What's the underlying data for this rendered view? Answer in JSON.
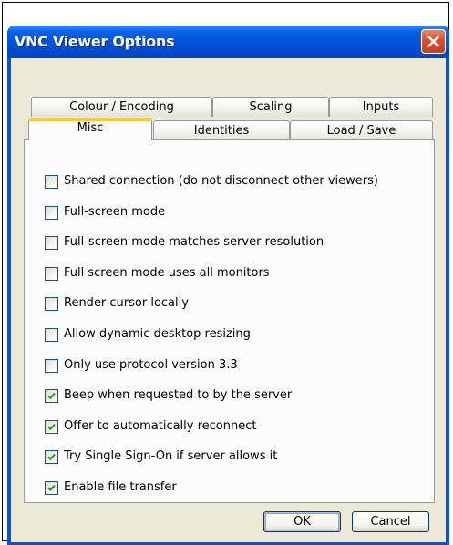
{
  "window": {
    "title": "VNC Viewer Options"
  },
  "tabs": {
    "row_back": [
      {
        "label": "Colour / Encoding"
      },
      {
        "label": "Scaling"
      },
      {
        "label": "Inputs"
      }
    ],
    "row_front": [
      {
        "label": "Misc",
        "selected": true
      },
      {
        "label": "Identities"
      },
      {
        "label": "Load / Save"
      }
    ]
  },
  "options": [
    {
      "label": "Shared connection (do not disconnect other viewers)",
      "checked": false
    },
    {
      "label": "Full-screen mode",
      "checked": false
    },
    {
      "label": "Full-screen mode matches server resolution",
      "checked": false
    },
    {
      "label": "Full screen mode uses all monitors",
      "checked": false
    },
    {
      "label": "Render cursor locally",
      "checked": false
    },
    {
      "label": "Allow dynamic desktop resizing",
      "checked": false
    },
    {
      "label": "Only use protocol version 3.3",
      "checked": false
    },
    {
      "label": "Beep when requested to by the server",
      "checked": true
    },
    {
      "label": "Offer to automatically reconnect",
      "checked": true
    },
    {
      "label": "Try Single Sign-On if server allows it",
      "checked": true
    },
    {
      "label": "Enable file transfer",
      "checked": true
    }
  ],
  "buttons": {
    "ok_label": "OK",
    "cancel_label": "Cancel"
  },
  "colors": {
    "titlebar_blue": "#0452d8",
    "close_red": "#d9512f",
    "dialog_face": "#ece9d8",
    "selected_tab_accent": "#ffc83c",
    "checkmark_green": "#21a121"
  },
  "icons": {
    "close": "close-icon",
    "check": "checkmark-icon"
  }
}
